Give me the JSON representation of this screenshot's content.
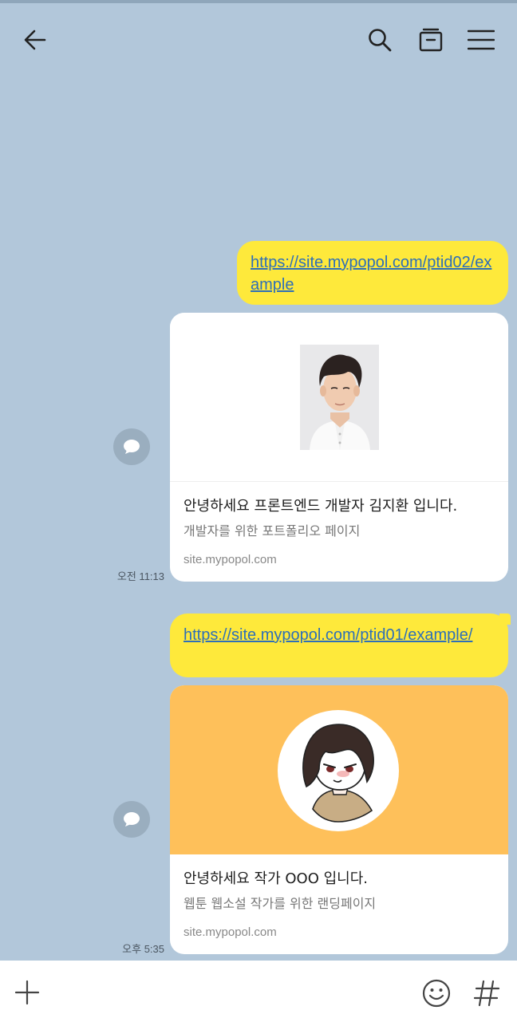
{
  "header": {
    "back_icon": "arrow-left-icon",
    "search_icon": "search-icon",
    "drawer_icon": "drawer-icon",
    "menu_icon": "hamburger-menu-icon"
  },
  "messages": [
    {
      "link": "https://site.mypopol.com/ptid02/example",
      "preview": {
        "title": "안녕하세요 프론트엔드 개발자 김지환 입니다.",
        "description": "개발자를 위한 포트폴리오 페이지",
        "domain": "site.mypopol.com"
      },
      "time": "오전 11:13"
    },
    {
      "link": "https://site.mypopol.com/ptid01/example/",
      "preview": {
        "title": "안녕하세요 작가 OOO 입니다.",
        "description": "웹툰 웹소설 작가를 위한 랜딩페이지",
        "domain": "site.mypopol.com"
      },
      "time": "오후 5:35"
    }
  ],
  "input_bar": {
    "plus_icon": "plus-icon",
    "emoji_icon": "emoji-icon",
    "hash_icon": "hashtag-icon"
  },
  "colors": {
    "background": "#b2c7da",
    "bubble": "#fee93b",
    "link": "#2e6fb8",
    "card2_banner": "#fec05a"
  }
}
